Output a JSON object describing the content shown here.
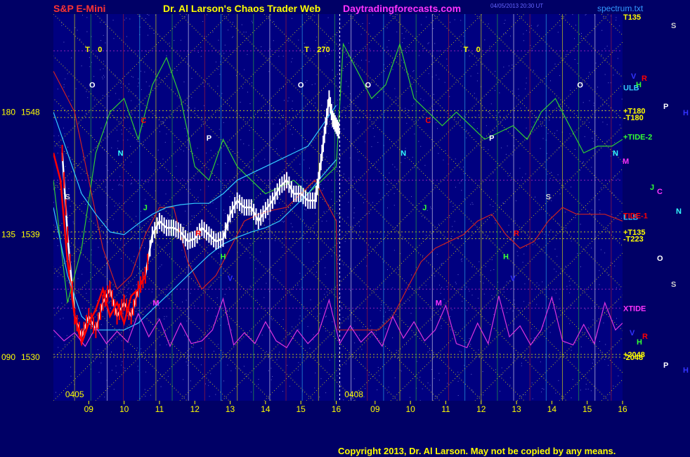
{
  "header": {
    "instrument": "S&P E-Mini",
    "title": "Dr. Al Larson's Chaos Trader Web",
    "site": "Daytradingforecasts.com",
    "timestamp": "04/05/2013 20:30 UT",
    "file": "spectrum.txt"
  },
  "footer": {
    "copyright": "Copyright 2013, Dr. Al Larson. May not be copied by any means."
  },
  "colors": {
    "background": "#000066",
    "plot_bg": "#000080",
    "price_white": "#ffffff",
    "price_red": "#ff0000",
    "green_line": "#33cc33",
    "red_line": "#cc2222",
    "cyan_line": "#33ccff",
    "magenta_tide": "#dd33dd",
    "yellow_dotted": "#ffff00",
    "header_red": "#ff3333",
    "header_yellow": "#ffff00",
    "header_magenta": "#ff33ff"
  },
  "chart_data": {
    "type": "line",
    "y_axis_labels": [
      {
        "angle": "180",
        "price": "1548",
        "value": 1548
      },
      {
        "angle": "135",
        "price": "1539",
        "value": 1539
      },
      {
        "angle": "090",
        "price": "1530",
        "value": 1530
      }
    ],
    "ylim": [
      1526.8,
      1555.2
    ],
    "x_ticks": [
      "09",
      "10",
      "11",
      "12",
      "13",
      "14",
      "15",
      "16",
      "09",
      "10",
      "11",
      "12",
      "13",
      "14",
      "15",
      "16"
    ],
    "date_labels": [
      "0405",
      "0408"
    ],
    "top_markers": [
      {
        "label": "T",
        "value": "0"
      },
      {
        "label": "T",
        "value": "270"
      },
      {
        "label": "T",
        "value": "0"
      }
    ],
    "right_labels": [
      {
        "text": "T135",
        "price": 1555.0,
        "color": "#ffff00"
      },
      {
        "text": "ULB",
        "price": 1549.8,
        "color": "#33ccff"
      },
      {
        "text": "+T180",
        "price": 1548.1,
        "color": "#ffff00"
      },
      {
        "text": "-T180",
        "price": 1547.6,
        "color": "#ffff00"
      },
      {
        "text": "+TIDE-2",
        "price": 1546.2,
        "color": "#33ff33"
      },
      {
        "text": "LLB",
        "price": 1540.3,
        "color": "#33ccff"
      },
      {
        "text": "TIDE-1",
        "price": 1540.4,
        "color": "#ff0000"
      },
      {
        "text": "+T135",
        "price": 1539.2,
        "color": "#ffff00"
      },
      {
        "text": "-T223",
        "price": 1538.7,
        "color": "#ffff00"
      },
      {
        "text": "XTIDE",
        "price": 1533.6,
        "color": "#ff33ff"
      },
      {
        "text": "+2048",
        "price": 1530.2,
        "color": "#ffff00"
      },
      {
        "text": "-2048",
        "price": 1530.0,
        "color": "#ffff00"
      }
    ],
    "side_letters": [
      {
        "text": "S",
        "color": "#cccccc"
      },
      {
        "text": "V",
        "color": "#3333ff"
      },
      {
        "text": "R",
        "color": "#ff0000"
      },
      {
        "text": "H",
        "color": "#33ff33"
      },
      {
        "text": "P",
        "color": "#ffffff"
      },
      {
        "text": "H",
        "color": "#3333ff"
      },
      {
        "text": "M",
        "color": "#ff33ff"
      },
      {
        "text": "J",
        "color": "#33ff33"
      },
      {
        "text": "C",
        "color": "#ff33ff"
      },
      {
        "text": "N",
        "color": "#33ffff"
      },
      {
        "text": "O",
        "color": "#ffffff"
      },
      {
        "text": "S",
        "color": "#cccccc"
      },
      {
        "text": "V",
        "color": "#3333ff"
      },
      {
        "text": "R",
        "color": "#ff0000"
      },
      {
        "text": "H",
        "color": "#33ff33"
      },
      {
        "text": "P",
        "color": "#ffffff"
      },
      {
        "text": "H",
        "color": "#3333ff"
      }
    ],
    "plot_letters": [
      {
        "text": "O",
        "color": "#ffffff"
      },
      {
        "text": "O",
        "color": "#ffffff"
      },
      {
        "text": "O",
        "color": "#ffffff"
      },
      {
        "text": "O",
        "color": "#ffffff"
      },
      {
        "text": "C",
        "color": "#ff0000"
      },
      {
        "text": "C",
        "color": "#ff0000"
      },
      {
        "text": "N",
        "color": "#33ffff"
      },
      {
        "text": "N",
        "color": "#33ffff"
      },
      {
        "text": "N",
        "color": "#33ffff"
      },
      {
        "text": "P",
        "color": "#ffffff"
      },
      {
        "text": "P",
        "color": "#ffffff"
      },
      {
        "text": "S",
        "color": "#cccccc"
      },
      {
        "text": "S",
        "color": "#cccccc"
      },
      {
        "text": "J",
        "color": "#33ff33"
      },
      {
        "text": "J",
        "color": "#33ff33"
      },
      {
        "text": "R",
        "color": "#ff0000"
      },
      {
        "text": "R",
        "color": "#ff0000"
      },
      {
        "text": "H",
        "color": "#33ff33"
      },
      {
        "text": "H",
        "color": "#33ff33"
      },
      {
        "text": "V",
        "color": "#3333ff"
      },
      {
        "text": "V",
        "color": "#3333ff"
      },
      {
        "text": "M",
        "color": "#ff33ff"
      },
      {
        "text": "M",
        "color": "#ff33ff"
      }
    ],
    "series": [
      {
        "name": "S&P E-Mini",
        "color": "#ffffff",
        "x": [
          8.25,
          8.4,
          8.6,
          8.8,
          9.0,
          9.2,
          9.4,
          9.6,
          9.8,
          10.0,
          10.2,
          10.4,
          10.6,
          10.8,
          11.0,
          11.2,
          11.4,
          11.6,
          11.8,
          12.0,
          12.2,
          12.4,
          12.6,
          12.8,
          13.0,
          13.2,
          13.4,
          13.6,
          13.8,
          14.0,
          14.2,
          14.4,
          14.6,
          14.8,
          15.0,
          15.2,
          15.4,
          15.5,
          15.6,
          15.7,
          15.8,
          15.9,
          16.0,
          16.1
        ],
        "y": [
          1545,
          1539,
          1533,
          1531.5,
          1533,
          1532,
          1534,
          1535,
          1533,
          1534,
          1533,
          1535,
          1536,
          1539,
          1540,
          1539.5,
          1539.5,
          1539.2,
          1538.5,
          1538.7,
          1539.5,
          1539,
          1538.5,
          1538.7,
          1540.5,
          1541.5,
          1541,
          1541,
          1540,
          1540.8,
          1541.5,
          1542.5,
          1543,
          1542,
          1542,
          1541.5,
          1541.5,
          1543,
          1545,
          1547,
          1549,
          1547.5,
          1547,
          1546.5
        ]
      },
      {
        "name": "",
        "color": "#ff0000",
        "x": [
          8.0,
          8.2,
          8.4,
          8.6,
          8.8,
          9.0,
          9.2,
          9.4,
          9.6,
          9.8,
          10.0,
          10.2,
          10.4,
          10.6
        ],
        "y": [
          1545,
          1543,
          1537,
          1533,
          1531,
          1532.5,
          1533.5,
          1535,
          1533,
          1534,
          1532.5,
          1534.5,
          1535,
          1536
        ]
      },
      {
        "name": "",
        "color": "#33cc33",
        "x": [
          8.0,
          8.4,
          8.8,
          9.2,
          9.6,
          10.0,
          10.4,
          10.8,
          11.2,
          11.6,
          12.0,
          12.4,
          12.8,
          13.2,
          13.6,
          14.0,
          14.4,
          14.8,
          15.2,
          15.6,
          16.0,
          16.2,
          16.6,
          17.0,
          17.4,
          17.8,
          18.2,
          18.6,
          19.0,
          19.4,
          19.8,
          20.2,
          20.6,
          21.0,
          21.4,
          21.8,
          22.2,
          22.6,
          23.0,
          23.4,
          23.8,
          24.1
        ],
        "y": [
          1543,
          1534,
          1538,
          1545,
          1548,
          1549,
          1546,
          1550,
          1552,
          1549,
          1544,
          1543,
          1546,
          1544,
          1543,
          1542,
          1542.5,
          1543,
          1542,
          1543,
          1544,
          1553,
          1551,
          1549,
          1550,
          1553,
          1549,
          1548,
          1547,
          1548,
          1547,
          1546,
          1546.5,
          1547,
          1546,
          1548,
          1549,
          1547,
          1545,
          1545.5,
          1545.5,
          1546
        ]
      },
      {
        "name": "",
        "color": "#cc2222",
        "x": [
          8.0,
          8.6,
          9.0,
          9.4,
          9.8,
          10.2,
          10.6,
          11.0,
          11.4,
          11.8,
          12.2,
          12.6,
          13.0,
          13.4,
          13.8,
          14.2,
          14.6,
          15.0,
          15.4,
          15.8,
          16.0,
          16.05,
          16.4,
          16.8,
          17.2,
          17.6,
          18.0,
          18.4,
          18.8,
          19.2,
          19.6,
          20.0,
          20.4,
          20.8,
          21.2,
          21.6,
          22.0,
          22.4,
          22.8,
          23.2,
          23.6,
          24.1
        ],
        "y": [
          1551,
          1548,
          1543,
          1538,
          1535,
          1536,
          1539,
          1541,
          1541,
          1537,
          1535,
          1536,
          1538,
          1540,
          1540.5,
          1540.8,
          1541,
          1542,
          1543,
          1541,
          1540,
          1532,
          1532,
          1532,
          1532,
          1533,
          1535,
          1537,
          1538,
          1538.5,
          1539,
          1540,
          1540.5,
          1539,
          1538,
          1538.5,
          1540,
          1541,
          1540.5,
          1540.5,
          1540.5,
          1540
        ]
      },
      {
        "name": "",
        "color": "#33ccff",
        "x": [
          8.0,
          8.4,
          8.8,
          9.2,
          9.6,
          10.0,
          10.4,
          10.8,
          11.2,
          11.6,
          12.0,
          12.4,
          12.8,
          13.2,
          13.6,
          14.0,
          14.4,
          14.8,
          15.2,
          15.6,
          16.0
        ],
        "y": [
          1548,
          1545,
          1542,
          1540.5,
          1539.2,
          1539,
          1539.8,
          1540.5,
          1541,
          1541.2,
          1541.3,
          1541.3,
          1542,
          1543,
          1543.5,
          1544,
          1544.5,
          1545,
          1545.5,
          1547,
          1548.5
        ]
      },
      {
        "name": "",
        "color": "#33ccff",
        "x": [
          8.0,
          8.4,
          8.8,
          9.2,
          9.6,
          10.0,
          10.4,
          10.8,
          11.2,
          11.6,
          12.0,
          12.4,
          12.8,
          13.2,
          13.6,
          14.0,
          14.4,
          14.8,
          15.2,
          15.6,
          16.0
        ],
        "y": [
          1541,
          1536,
          1533,
          1532,
          1532,
          1532,
          1532.5,
          1533.5,
          1534.5,
          1535.5,
          1536.5,
          1537.5,
          1538.3,
          1538.8,
          1539.2,
          1539.5,
          1540,
          1541,
          1542,
          1543.3,
          1544.5
        ]
      },
      {
        "name": "",
        "color": "#dd33dd",
        "x": [
          8.0,
          8.3,
          8.6,
          8.9,
          9.2,
          9.5,
          9.8,
          10.1,
          10.4,
          10.7,
          11.0,
          11.3,
          11.6,
          11.9,
          12.2,
          12.5,
          12.8,
          13.1,
          13.4,
          13.7,
          14.0,
          14.3,
          14.6,
          14.9,
          15.2,
          15.5,
          15.8,
          16.1,
          16.4,
          16.7,
          17.0,
          17.3,
          17.6,
          17.9,
          18.2,
          18.5,
          18.8,
          19.1,
          19.4,
          19.7,
          20.0,
          20.3,
          20.6,
          20.9,
          21.2,
          21.5,
          21.8,
          22.1,
          22.4,
          22.7,
          23.0,
          23.3,
          23.6,
          23.9,
          24.1
        ],
        "y": [
          1532.0,
          1531.2,
          1531.8,
          1530.8,
          1532.2,
          1531.0,
          1531.9,
          1531.1,
          1533.2,
          1531.5,
          1532.8,
          1530.8,
          1532.5,
          1531.0,
          1531.2,
          1532.0,
          1534.3,
          1530.9,
          1531.8,
          1531.0,
          1532.6,
          1531.2,
          1530.7,
          1532.0,
          1531.0,
          1531.8,
          1534.2,
          1531.0,
          1532.3,
          1531.1,
          1531.9,
          1530.8,
          1533.0,
          1531.4,
          1532.6,
          1531.2,
          1532.0,
          1533.8,
          1531.0,
          1530.7,
          1532.5,
          1531.0,
          1534.5,
          1531.5,
          1532.3,
          1530.9,
          1532.0,
          1534.4,
          1531.2,
          1530.9,
          1532.4,
          1531.0,
          1534.0,
          1532.0,
          1532.5
        ]
      }
    ]
  }
}
